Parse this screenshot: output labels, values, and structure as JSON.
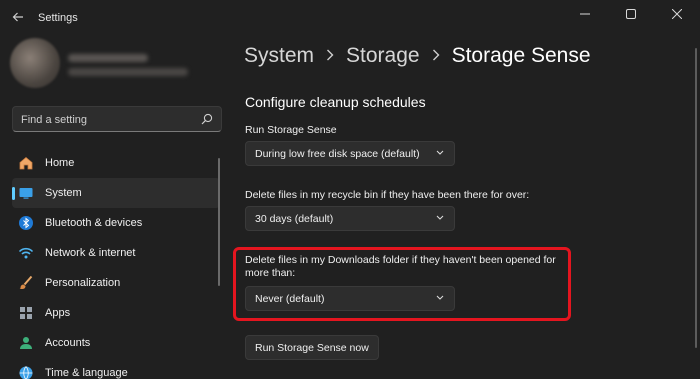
{
  "window": {
    "title": "Settings"
  },
  "search": {
    "placeholder": "Find a setting"
  },
  "sidebar": {
    "items": [
      {
        "label": "Home",
        "icon": "home-icon"
      },
      {
        "label": "System",
        "icon": "system-icon",
        "active": true
      },
      {
        "label": "Bluetooth & devices",
        "icon": "bluetooth-icon"
      },
      {
        "label": "Network & internet",
        "icon": "wifi-icon"
      },
      {
        "label": "Personalization",
        "icon": "brush-icon"
      },
      {
        "label": "Apps",
        "icon": "apps-icon"
      },
      {
        "label": "Accounts",
        "icon": "accounts-icon"
      },
      {
        "label": "Time & language",
        "icon": "globe-icon"
      }
    ]
  },
  "breadcrumb": {
    "items": [
      "System",
      "Storage",
      "Storage Sense"
    ]
  },
  "main": {
    "section_title": "Configure cleanup schedules",
    "run_label": "Run Storage Sense",
    "run_value": "During low free disk space (default)",
    "recycle_label": "Delete files in my recycle bin if they have been there for over:",
    "recycle_value": "30 days (default)",
    "downloads_label_line1": "Delete files in my Downloads folder if they haven't been opened for",
    "downloads_label_line2": "more than:",
    "downloads_value": "Never (default)",
    "run_now_button": "Run Storage Sense now"
  },
  "colors": {
    "accent": "#60cdff",
    "highlight": "#e4151f",
    "background": "#202020"
  }
}
